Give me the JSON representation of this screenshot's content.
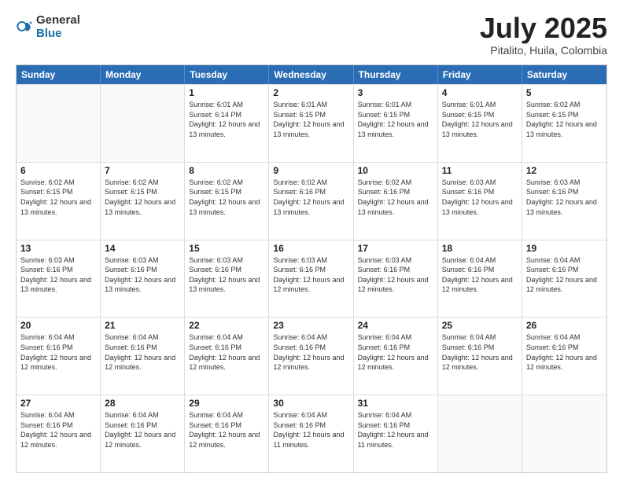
{
  "logo": {
    "general": "General",
    "blue": "Blue"
  },
  "title": {
    "month": "July 2025",
    "location": "Pitalito, Huila, Colombia"
  },
  "header_days": [
    "Sunday",
    "Monday",
    "Tuesday",
    "Wednesday",
    "Thursday",
    "Friday",
    "Saturday"
  ],
  "weeks": [
    [
      {
        "day": "",
        "sunrise": "",
        "sunset": "",
        "daylight": ""
      },
      {
        "day": "",
        "sunrise": "",
        "sunset": "",
        "daylight": ""
      },
      {
        "day": "1",
        "sunrise": "Sunrise: 6:01 AM",
        "sunset": "Sunset: 6:14 PM",
        "daylight": "Daylight: 12 hours and 13 minutes."
      },
      {
        "day": "2",
        "sunrise": "Sunrise: 6:01 AM",
        "sunset": "Sunset: 6:15 PM",
        "daylight": "Daylight: 12 hours and 13 minutes."
      },
      {
        "day": "3",
        "sunrise": "Sunrise: 6:01 AM",
        "sunset": "Sunset: 6:15 PM",
        "daylight": "Daylight: 12 hours and 13 minutes."
      },
      {
        "day": "4",
        "sunrise": "Sunrise: 6:01 AM",
        "sunset": "Sunset: 6:15 PM",
        "daylight": "Daylight: 12 hours and 13 minutes."
      },
      {
        "day": "5",
        "sunrise": "Sunrise: 6:02 AM",
        "sunset": "Sunset: 6:15 PM",
        "daylight": "Daylight: 12 hours and 13 minutes."
      }
    ],
    [
      {
        "day": "6",
        "sunrise": "Sunrise: 6:02 AM",
        "sunset": "Sunset: 6:15 PM",
        "daylight": "Daylight: 12 hours and 13 minutes."
      },
      {
        "day": "7",
        "sunrise": "Sunrise: 6:02 AM",
        "sunset": "Sunset: 6:15 PM",
        "daylight": "Daylight: 12 hours and 13 minutes."
      },
      {
        "day": "8",
        "sunrise": "Sunrise: 6:02 AM",
        "sunset": "Sunset: 6:15 PM",
        "daylight": "Daylight: 12 hours and 13 minutes."
      },
      {
        "day": "9",
        "sunrise": "Sunrise: 6:02 AM",
        "sunset": "Sunset: 6:16 PM",
        "daylight": "Daylight: 12 hours and 13 minutes."
      },
      {
        "day": "10",
        "sunrise": "Sunrise: 6:02 AM",
        "sunset": "Sunset: 6:16 PM",
        "daylight": "Daylight: 12 hours and 13 minutes."
      },
      {
        "day": "11",
        "sunrise": "Sunrise: 6:03 AM",
        "sunset": "Sunset: 6:16 PM",
        "daylight": "Daylight: 12 hours and 13 minutes."
      },
      {
        "day": "12",
        "sunrise": "Sunrise: 6:03 AM",
        "sunset": "Sunset: 6:16 PM",
        "daylight": "Daylight: 12 hours and 13 minutes."
      }
    ],
    [
      {
        "day": "13",
        "sunrise": "Sunrise: 6:03 AM",
        "sunset": "Sunset: 6:16 PM",
        "daylight": "Daylight: 12 hours and 13 minutes."
      },
      {
        "day": "14",
        "sunrise": "Sunrise: 6:03 AM",
        "sunset": "Sunset: 6:16 PM",
        "daylight": "Daylight: 12 hours and 13 minutes."
      },
      {
        "day": "15",
        "sunrise": "Sunrise: 6:03 AM",
        "sunset": "Sunset: 6:16 PM",
        "daylight": "Daylight: 12 hours and 13 minutes."
      },
      {
        "day": "16",
        "sunrise": "Sunrise: 6:03 AM",
        "sunset": "Sunset: 6:16 PM",
        "daylight": "Daylight: 12 hours and 12 minutes."
      },
      {
        "day": "17",
        "sunrise": "Sunrise: 6:03 AM",
        "sunset": "Sunset: 6:16 PM",
        "daylight": "Daylight: 12 hours and 12 minutes."
      },
      {
        "day": "18",
        "sunrise": "Sunrise: 6:04 AM",
        "sunset": "Sunset: 6:16 PM",
        "daylight": "Daylight: 12 hours and 12 minutes."
      },
      {
        "day": "19",
        "sunrise": "Sunrise: 6:04 AM",
        "sunset": "Sunset: 6:16 PM",
        "daylight": "Daylight: 12 hours and 12 minutes."
      }
    ],
    [
      {
        "day": "20",
        "sunrise": "Sunrise: 6:04 AM",
        "sunset": "Sunset: 6:16 PM",
        "daylight": "Daylight: 12 hours and 12 minutes."
      },
      {
        "day": "21",
        "sunrise": "Sunrise: 6:04 AM",
        "sunset": "Sunset: 6:16 PM",
        "daylight": "Daylight: 12 hours and 12 minutes."
      },
      {
        "day": "22",
        "sunrise": "Sunrise: 6:04 AM",
        "sunset": "Sunset: 6:16 PM",
        "daylight": "Daylight: 12 hours and 12 minutes."
      },
      {
        "day": "23",
        "sunrise": "Sunrise: 6:04 AM",
        "sunset": "Sunset: 6:16 PM",
        "daylight": "Daylight: 12 hours and 12 minutes."
      },
      {
        "day": "24",
        "sunrise": "Sunrise: 6:04 AM",
        "sunset": "Sunset: 6:16 PM",
        "daylight": "Daylight: 12 hours and 12 minutes."
      },
      {
        "day": "25",
        "sunrise": "Sunrise: 6:04 AM",
        "sunset": "Sunset: 6:16 PM",
        "daylight": "Daylight: 12 hours and 12 minutes."
      },
      {
        "day": "26",
        "sunrise": "Sunrise: 6:04 AM",
        "sunset": "Sunset: 6:16 PM",
        "daylight": "Daylight: 12 hours and 12 minutes."
      }
    ],
    [
      {
        "day": "27",
        "sunrise": "Sunrise: 6:04 AM",
        "sunset": "Sunset: 6:16 PM",
        "daylight": "Daylight: 12 hours and 12 minutes."
      },
      {
        "day": "28",
        "sunrise": "Sunrise: 6:04 AM",
        "sunset": "Sunset: 6:16 PM",
        "daylight": "Daylight: 12 hours and 12 minutes."
      },
      {
        "day": "29",
        "sunrise": "Sunrise: 6:04 AM",
        "sunset": "Sunset: 6:16 PM",
        "daylight": "Daylight: 12 hours and 12 minutes."
      },
      {
        "day": "30",
        "sunrise": "Sunrise: 6:04 AM",
        "sunset": "Sunset: 6:16 PM",
        "daylight": "Daylight: 12 hours and 11 minutes."
      },
      {
        "day": "31",
        "sunrise": "Sunrise: 6:04 AM",
        "sunset": "Sunset: 6:16 PM",
        "daylight": "Daylight: 12 hours and 11 minutes."
      },
      {
        "day": "",
        "sunrise": "",
        "sunset": "",
        "daylight": ""
      },
      {
        "day": "",
        "sunrise": "",
        "sunset": "",
        "daylight": ""
      }
    ]
  ]
}
